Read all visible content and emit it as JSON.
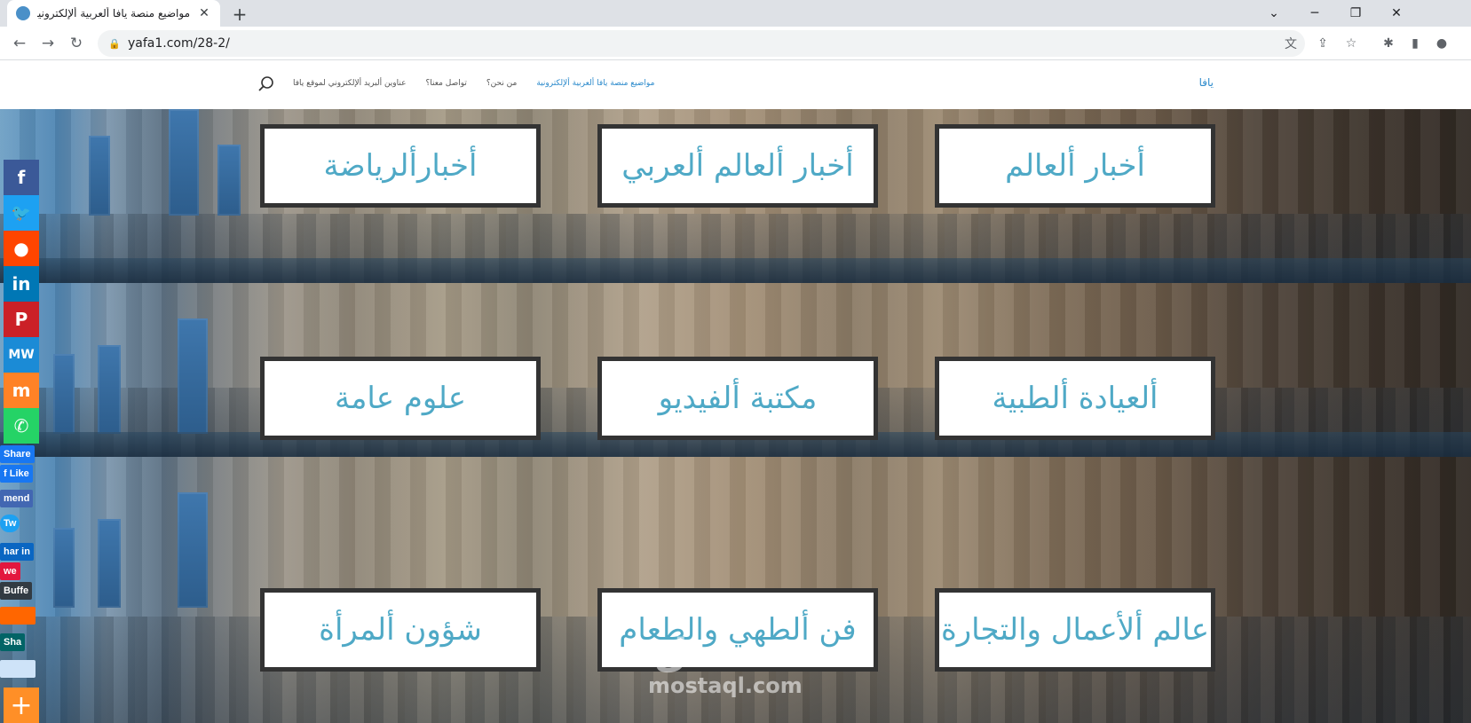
{
  "browser": {
    "tab_title": "مواضيع منصة يافا ألعربية ألإلكترونية",
    "url": "yafa1.com/28-2/",
    "new_tab": "+",
    "tab_close": "✕"
  },
  "header": {
    "brand": "يافا",
    "nav": [
      {
        "label": "مواضيع منصة يافا ألعربية ألإلكترونية",
        "active": true
      },
      {
        "label": "من نحن؟",
        "active": false
      },
      {
        "label": "تواصل معنا؟",
        "active": false
      },
      {
        "label": "عناوين ألبريد ألإلكتروني لموقع يافا",
        "active": false
      }
    ]
  },
  "cards": [
    {
      "label": "أخبار ألعالم"
    },
    {
      "label": "أخبار ألعالم ألعربي"
    },
    {
      "label": "أخبارألرياضة"
    },
    {
      "label": "ألعيادة ألطبية"
    },
    {
      "label": "مكتبة ألفيديو"
    },
    {
      "label": "علوم عامة"
    },
    {
      "label": "عالم ألأعمال والتجارة"
    },
    {
      "label": "فن ألطهي والطعام"
    },
    {
      "label": "شؤون ألمرأة"
    }
  ],
  "social": {
    "buttons": [
      {
        "name": "facebook",
        "glyph": "f",
        "color": "#3b5998"
      },
      {
        "name": "twitter",
        "glyph": "🐦",
        "color": "#1da1f2"
      },
      {
        "name": "reddit",
        "glyph": "●",
        "color": "#ff4500"
      },
      {
        "name": "linkedin",
        "glyph": "in",
        "color": "#0077b5"
      },
      {
        "name": "pinterest",
        "glyph": "P",
        "color": "#cb2027"
      },
      {
        "name": "mewe",
        "glyph": "MW",
        "color": "#1b8bd6"
      },
      {
        "name": "mix",
        "glyph": "m",
        "color": "#ff8226"
      },
      {
        "name": "whatsapp",
        "glyph": "✆",
        "color": "#25d366"
      }
    ],
    "mini": [
      {
        "label": "Share",
        "color": "#1877f2"
      },
      {
        "label": "f Like",
        "color": "#1877f2"
      },
      {
        "label": "mend",
        "color": "#4267b2"
      },
      {
        "label": "Tw",
        "color": "#1da1f2"
      },
      {
        "label": "har in",
        "color": "#0a66c2"
      },
      {
        "label": "we",
        "color": "#e3173e"
      },
      {
        "label": "Buffe",
        "color": "#323b43"
      },
      {
        "label": "",
        "color": "#ff6600"
      },
      {
        "label": "Sha",
        "color": "#026466"
      },
      {
        "label": "",
        "color": "#cee3f8"
      }
    ],
    "more": "+"
  },
  "watermark": {
    "arabic": "مستقل",
    "latin": "mostaql.com"
  }
}
